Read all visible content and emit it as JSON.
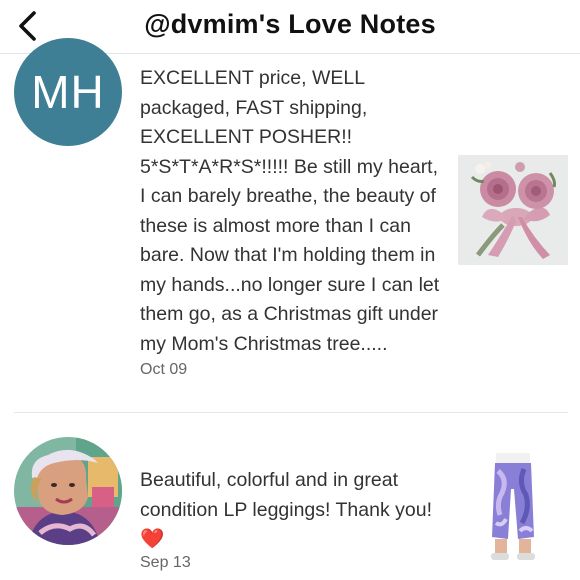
{
  "header": {
    "title": "@dvmim's Love Notes",
    "back_icon": "chevron-left-icon"
  },
  "notes": [
    {
      "author_initials": "MH",
      "avatar_color": "#3f7f95",
      "text": "EXCELLENT price, WELL packaged, FAST shipping, EXCELLENT POSHER!! 5*S*T*A*R*S*!!!!! Be still my heart, I can barely breathe, the beauty of these is almost more than I can bare. Now that I'm holding them in my hands...no longer sure I can let them go, as a Christmas gift under my Mom's Christmas tree.....",
      "date": "Oct 09",
      "item_image": "pink-roses-bow-photo"
    },
    {
      "author_image": "profile-photo-woman-visor",
      "text": "Beautiful, colorful and in great condition LP leggings! Thank you!",
      "emoji": "❤️",
      "date": "Sep 13",
      "item_image": "purple-print-leggings-photo"
    }
  ]
}
